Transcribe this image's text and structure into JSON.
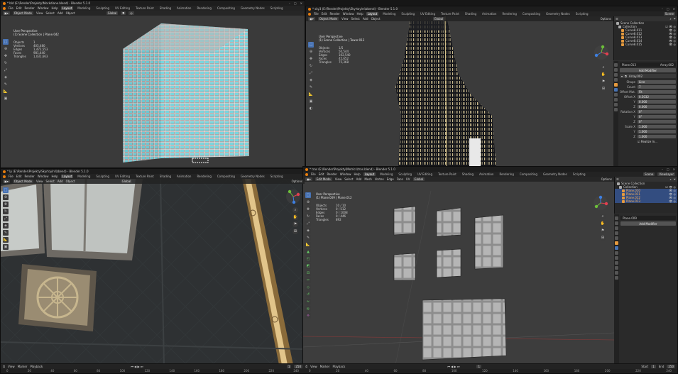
{
  "windows": [
    {
      "title": "* bld (E:\\Render\\Projekty\\Mockdiane.blend) - Blender 5.1.0",
      "menus": [
        "File",
        "Edit",
        "Render",
        "Window",
        "Help"
      ],
      "workspaces": [
        "Layout",
        "Modeling",
        "Sculpting",
        "UV Editing",
        "Texture Paint",
        "Shading",
        "Animation",
        "Rendering",
        "Compositing",
        "Geometry Nodes",
        "Scripting"
      ],
      "mode": "Object Mode",
      "viewmenus": [
        "View",
        "Select",
        "Add",
        "Object"
      ],
      "transform": "Global",
      "perspective": "User Perspective",
      "collection": "(1) Scene Collection | Plane.042",
      "stats": [
        [
          "Objects",
          "1"
        ],
        [
          "Vertices",
          "405,480"
        ],
        [
          "Edges",
          "1,472,553"
        ],
        [
          "Faces",
          "981,440"
        ],
        [
          "Triangles",
          "1,031,663"
        ]
      ]
    },
    {
      "title": "* sky3 (E:\\Render\\Projekty\\Skyrtoylrs\\bbend) - Blender 5.1.0",
      "menus": [
        "File",
        "Edit",
        "Render",
        "Window",
        "Help"
      ],
      "workspaces": [
        "Layout",
        "Modeling",
        "Sculpting",
        "UV Editing",
        "Texture Paint",
        "Shading",
        "Animation",
        "Rendering",
        "Compositing",
        "Geometry Nodes",
        "Scripting"
      ],
      "mode": "Object Mode",
      "viewmenus": [
        "View",
        "Select",
        "Add",
        "Object"
      ],
      "transform": "Global",
      "perspective": "User Perspective",
      "collection": "(1) Scene Collection | Tower.013",
      "stats": [
        [
          "Objects",
          "1/5"
        ],
        [
          "Vertices",
          "50,544"
        ],
        [
          "Edges",
          "102,540"
        ],
        [
          "Faces",
          "45,652"
        ],
        [
          "Triangles",
          "75,368"
        ]
      ],
      "scene": "Scene",
      "options": "Options",
      "outliner": {
        "title": "Scene Collection",
        "items": [
          "Collection",
          "Curve8.011",
          "Curve8.012",
          "Curve8.013",
          "Curve8.014",
          "Curve8.015"
        ]
      },
      "props": {
        "object": "Plane.013",
        "modifier": "Array.002",
        "add_modifier": "Add Modifier",
        "fields": [
          [
            "Shape",
            "Line"
          ],
          [
            "Count",
            "7"
          ],
          [
            "Offset Mat.",
            "Fit"
          ],
          [
            "Offset X",
            "0.5032"
          ],
          [
            "Y",
            "0.000"
          ],
          [
            "Z",
            "0.000"
          ],
          [
            "Rotation X",
            "0°"
          ],
          [
            "Y",
            "0°"
          ],
          [
            "Z",
            "0°"
          ],
          [
            "Scale X",
            "1.000"
          ],
          [
            "Y",
            "1.000"
          ],
          [
            "Z",
            "1.000"
          ]
        ],
        "footer": "Realize In..."
      }
    },
    {
      "title": "* lp (E:\\Render\\Projekty\\Skyrtoylrs\\bbend) - Blender 5.1.0",
      "menus": [
        "File",
        "Edit",
        "Render",
        "Window",
        "Help"
      ],
      "workspaces": [
        "Layout",
        "Modeling",
        "Sculpting",
        "UV Editing",
        "Texture Paint",
        "Shading",
        "Animation",
        "Rendering",
        "Compositing",
        "Geometry Nodes",
        "Scripting"
      ],
      "mode": "Object Mode",
      "viewmenus": [
        "View",
        "Select",
        "Add",
        "Object"
      ],
      "transform": "Global",
      "options": "Options",
      "timeline_menus": [
        "View",
        "Marker",
        "Playback"
      ],
      "frame_start": "1",
      "frame_end": "250"
    },
    {
      "title": "* tras (E:\\Render\\Projekty\\Metrics\\tras.blend) - Blender 5.1.0",
      "menus": [
        "File",
        "Edit",
        "Render",
        "Window",
        "Help"
      ],
      "workspaces": [
        "Layout",
        "Modeling",
        "Sculpting",
        "UV Editing",
        "Texture Paint",
        "Shading",
        "Animation",
        "Rendering",
        "Compositing",
        "Geometry Nodes",
        "Scripting"
      ],
      "mode": "Edit Mode",
      "viewmenus": [
        "View",
        "Select",
        "Add",
        "Mesh",
        "Vertex",
        "Edge",
        "Face",
        "UV"
      ],
      "transform": "Global",
      "perspective": "User Perspective",
      "collection": "(1) Plane.009 | Plane.012",
      "stats": [
        [
          "Objects",
          "10 / 10"
        ],
        [
          "Vertices",
          "0 / 512"
        ],
        [
          "Edges",
          "0 / 1008"
        ],
        [
          "Faces",
          "0 / 446"
        ],
        [
          "Triangles",
          "892"
        ]
      ],
      "scene": "Scene",
      "viewlayer": "ViewLayer",
      "options": "Options",
      "outliner": {
        "title": "Scene Collection",
        "items": [
          "Collection",
          "Plane.010",
          "Plane.011",
          "Plane.012",
          "Plane.013"
        ]
      },
      "props": {
        "object": "Plane.009",
        "add_modifier": "Add Modifier"
      },
      "timeline_menus": [
        "View",
        "Marker",
        "Playback"
      ],
      "current_frame": "1",
      "frame_start": "1",
      "frame_end": "250",
      "start_label": "Start",
      "end_label": "End"
    }
  ],
  "ticks": [
    "0",
    "10",
    "20",
    "30",
    "40",
    "50",
    "60",
    "70",
    "80",
    "90",
    "100",
    "110",
    "120",
    "130",
    "140",
    "150",
    "160",
    "170",
    "180",
    "190",
    "200",
    "210",
    "220",
    "230",
    "240",
    "250"
  ],
  "colors": {
    "accent": "#4772b3",
    "orange": "#e87d0d",
    "wire": "#9fe8f0"
  }
}
